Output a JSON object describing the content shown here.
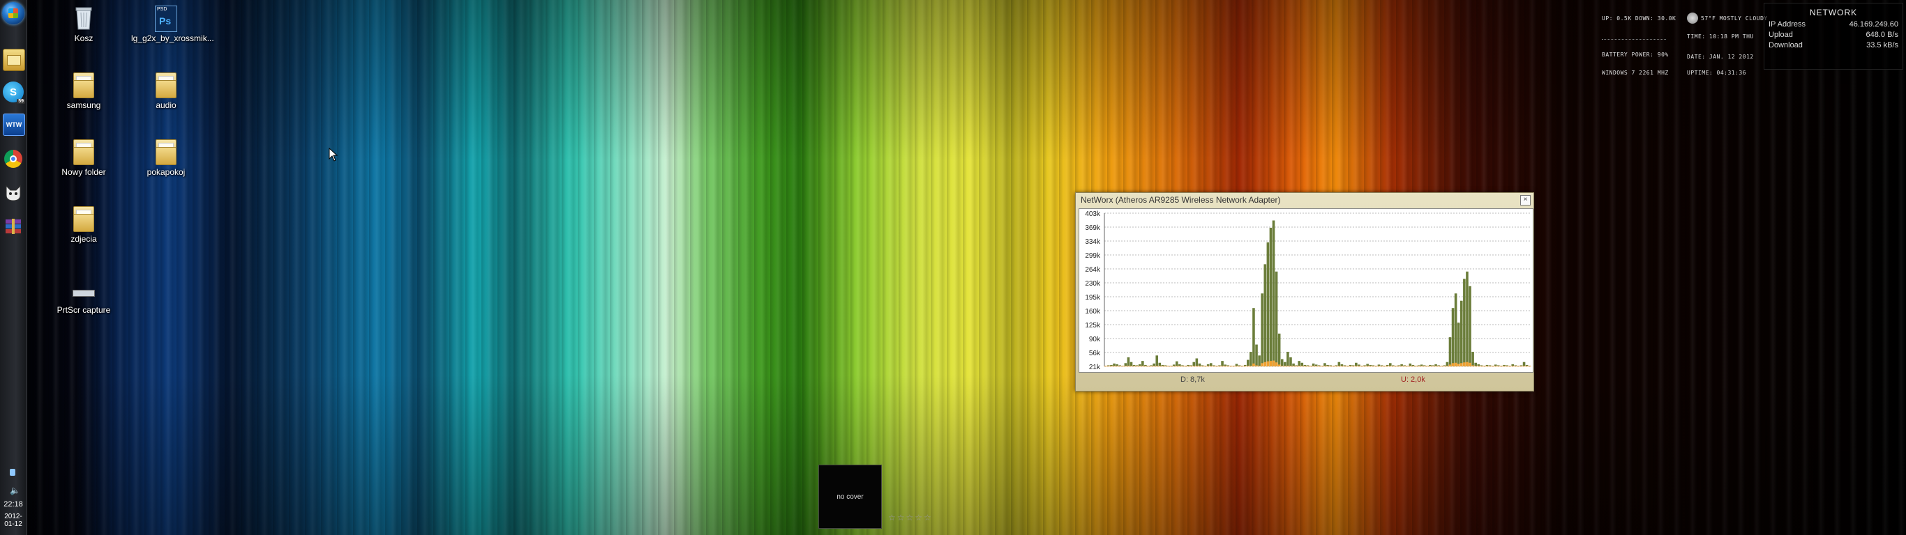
{
  "desktop": {
    "icons": [
      {
        "label": "Kosz",
        "icon": "recycle-bin-icon"
      },
      {
        "label": "lg_g2x_by_xrossmik...",
        "icon": "photoshop-file-icon",
        "badge": "PSD",
        "glyph": "Ps"
      },
      {
        "label": "samsung",
        "icon": "folder-icon"
      },
      {
        "label": "audio",
        "icon": "folder-icon"
      },
      {
        "label": "Nowy folder",
        "icon": "folder-icon"
      },
      {
        "label": "pokapokoj",
        "icon": "folder-icon"
      },
      {
        "label": "zdjecia",
        "icon": "folder-icon"
      },
      {
        "label": "PrtScr capture",
        "icon": "screen-capture-icon"
      }
    ]
  },
  "taskbar": {
    "items": [
      {
        "name": "start-button",
        "icon": "windows-orb-icon"
      },
      {
        "name": "explorer",
        "icon": "folder-icon"
      },
      {
        "name": "skype",
        "icon": "skype-icon",
        "badge": "59"
      },
      {
        "name": "wtw",
        "icon": "wtw-icon",
        "text": "WTW"
      },
      {
        "name": "chrome",
        "icon": "chrome-icon"
      },
      {
        "name": "cat-app",
        "icon": "cat-icon"
      },
      {
        "name": "winrar",
        "icon": "winrar-icon"
      }
    ],
    "time": "22:18",
    "date": "2012-01-12"
  },
  "sysinfo": {
    "up_down": "UP: 0.5K  DOWN: 30.0K",
    "weather": "57°F MOSTLY CLOUDY",
    "time": "TIME: 10:18 PM THU",
    "battery": "BATTERY POWER: 90%",
    "date": "DATE: JAN. 12 2012",
    "cpu": "WINDOWS 7 2261 MHZ",
    "uptime": "UPTIME: 04:31:36"
  },
  "network_panel": {
    "title": "NETWORK",
    "rows": [
      {
        "label": "IP Address",
        "value": "46.169.249.60"
      },
      {
        "label": "Upload",
        "value": "648.0 B/s"
      },
      {
        "label": "Download",
        "value": "33.5 kB/s"
      }
    ]
  },
  "networx": {
    "title": "NetWorx (Atheros AR9285 Wireless Network Adapter)",
    "close": "×",
    "download_label": "D: 8,7k",
    "upload_label": "U: 2,0k",
    "colors": {
      "download": "#6b7d3a",
      "upload": "#f0a030"
    }
  },
  "chart_data": {
    "type": "bar",
    "title": "",
    "xlabel": "",
    "ylabel": "",
    "y_ticks": [
      "403k",
      "369k",
      "334k",
      "299k",
      "264k",
      "230k",
      "195k",
      "160k",
      "125k",
      "90k",
      "56k",
      "21k"
    ],
    "ylim": [
      0,
      420000
    ],
    "series": [
      {
        "name": "D: 8,7k",
        "values": [
          2000,
          3000,
          4000,
          8000,
          6000,
          3000,
          2000,
          9000,
          25000,
          12000,
          4000,
          3000,
          6000,
          15000,
          4000,
          2000,
          3000,
          8000,
          30000,
          10000,
          4000,
          3000,
          2000,
          2000,
          5000,
          14000,
          6000,
          3000,
          2000,
          4000,
          3000,
          12000,
          22000,
          8000,
          3000,
          2000,
          6000,
          9000,
          3000,
          2000,
          3000,
          15000,
          5000,
          3000,
          2000,
          2000,
          7000,
          3000,
          2000,
          4000,
          18000,
          40000,
          160000,
          60000,
          30000,
          200000,
          280000,
          340000,
          380000,
          400000,
          260000,
          90000,
          20000,
          12000,
          40000,
          25000,
          8000,
          3000,
          15000,
          10000,
          4000,
          3000,
          2000,
          8000,
          5000,
          3000,
          2000,
          9000,
          4000,
          3000,
          2000,
          3000,
          12000,
          6000,
          3000,
          2000,
          4000,
          3000,
          10000,
          5000,
          2000,
          3000,
          7000,
          4000,
          3000,
          2000,
          5000,
          3000,
          2000,
          4000,
          9000,
          3000,
          2000,
          3000,
          6000,
          3000,
          2000,
          8000,
          4000,
          2000,
          3000,
          5000,
          3000,
          2000,
          4000,
          3000,
          6000,
          3000,
          2000,
          3000,
          12000,
          80000,
          160000,
          200000,
          120000,
          180000,
          240000,
          260000,
          220000,
          40000,
          10000,
          6000,
          3000,
          2000,
          4000,
          3000,
          2000,
          5000,
          3000,
          2000,
          4000,
          3000,
          2000,
          6000,
          3000,
          2000,
          3000,
          12000,
          4000,
          2000
        ]
      },
      {
        "name": "U: 2,0k",
        "values": [
          500,
          800,
          600,
          900,
          700,
          500,
          600,
          800,
          1200,
          700,
          500,
          600,
          800,
          900,
          600,
          500,
          600,
          700,
          1500,
          800,
          600,
          500,
          600,
          500,
          700,
          900,
          600,
          500,
          600,
          700,
          500,
          800,
          1400,
          700,
          500,
          600,
          700,
          800,
          500,
          600,
          500,
          900,
          600,
          500,
          600,
          500,
          700,
          600,
          500,
          600,
          1200,
          2000,
          8000,
          3000,
          2000,
          9000,
          12000,
          14000,
          15000,
          16000,
          11000,
          5000,
          1500,
          900,
          2000,
          1500,
          700,
          500,
          900,
          800,
          600,
          500,
          600,
          700,
          500,
          600,
          500,
          800,
          600,
          500,
          600,
          500,
          900,
          600,
          500,
          600,
          700,
          500,
          800,
          600,
          500,
          600,
          700,
          600,
          500,
          600,
          700,
          500,
          600,
          700,
          800,
          500,
          600,
          500,
          700,
          500,
          600,
          800,
          600,
          500,
          600,
          700,
          500,
          600,
          700,
          500,
          600,
          500,
          600,
          500,
          900,
          5000,
          9000,
          10000,
          7000,
          9000,
          11000,
          12000,
          10000,
          3000,
          900,
          700,
          500,
          600,
          700,
          500,
          600,
          700,
          500,
          600,
          700,
          500,
          600,
          700,
          500,
          600,
          500,
          900,
          600,
          500
        ]
      }
    ],
    "grid": true
  },
  "player": {
    "cover_text": "no cover",
    "rating": "☆☆☆☆☆"
  }
}
